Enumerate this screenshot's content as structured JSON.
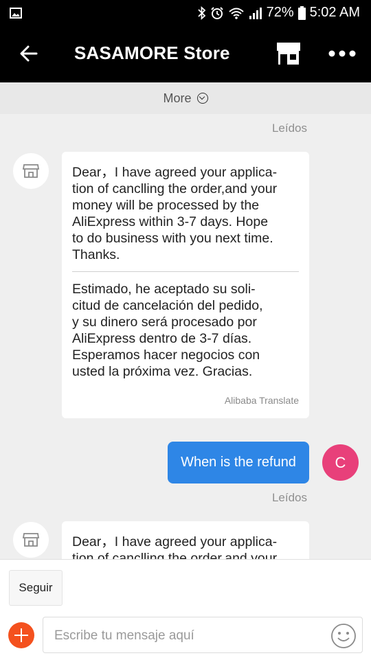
{
  "status_bar": {
    "battery": "72%",
    "time": "5:02 AM"
  },
  "header": {
    "title": "SASAMORE Store"
  },
  "chat": {
    "more_label": "More",
    "read_label": "Leídos",
    "messages": [
      {
        "original": "Dear，I have agreed your applica-\ntion of canclling the order,and your\nmoney will be processed by the\nAliExpress within 3-7 days. Hope\nto do business with you next time.\nThanks.",
        "translated": "Estimado, he aceptado su soli-\ncitud de cancelación del pedido,\ny su dinero será procesado por\nAliExpress dentro de 3-7 días.\nEsperamos hacer negocios con\nusted la próxima vez. Gracias.",
        "translation_label": "Alibaba Translate"
      },
      {
        "text": "When is the refund",
        "avatar_letter": "C"
      },
      {
        "original": "Dear，I have agreed your applica-\ntion of canclling the order,and your"
      }
    ]
  },
  "bottom": {
    "follow_label": "Seguir",
    "message_placeholder": "Escribe tu mensaje aquí"
  },
  "colors": {
    "accent": "#2e86e6",
    "avatar": "#e8407a",
    "plus": "#f4511e"
  }
}
